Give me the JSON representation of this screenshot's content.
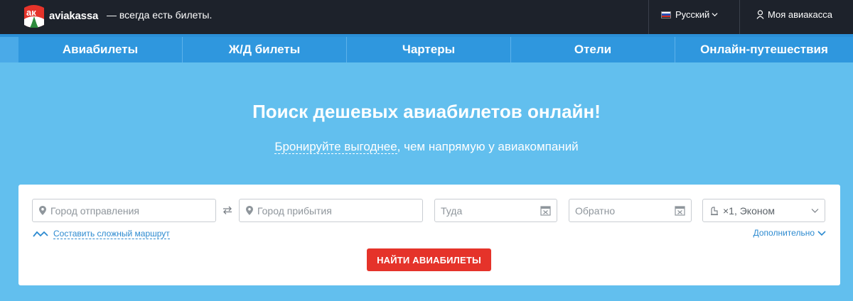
{
  "header": {
    "logo_text": "aviakassa",
    "tagline": "— всегда есть билеты.",
    "language": "Русский",
    "account": "Моя авиакасса",
    "icons": {
      "logo": "aviakassa-logo-icon",
      "flag": "russia-flag-icon",
      "user": "user-icon",
      "chevron": "chevron-down-icon"
    }
  },
  "nav": {
    "items": [
      {
        "label": "Авиабилеты"
      },
      {
        "label": "Ж/Д билеты"
      },
      {
        "label": "Чартеры"
      },
      {
        "label": "Отели"
      },
      {
        "label": "Онлайн-путешествия"
      }
    ]
  },
  "hero": {
    "title": "Поиск дешевых авиабилетов онлайн!",
    "subtitle_link": "Бронируйте выгоднее",
    "subtitle_rest": ", чем напрямую у авиакомпаний"
  },
  "search": {
    "from_placeholder": "Город отправления",
    "to_placeholder": "Город прибытия",
    "depart_placeholder": "Туда",
    "return_placeholder": "Обратно",
    "passengers": "×1, Эконом",
    "complex_route": "Составить сложный маршрут",
    "more": "Дополнительно",
    "submit": "НАЙТИ АВИАБИЛЕТЫ"
  },
  "colors": {
    "header_bg": "#1d222b",
    "page_bg": "#62bfee",
    "nav_bg": "#2f97de",
    "button": "#e5332a",
    "link": "#2c8ad0"
  }
}
